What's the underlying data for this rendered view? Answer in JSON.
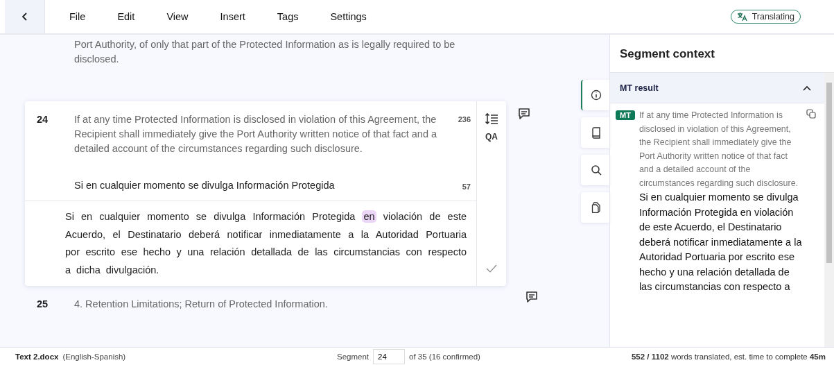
{
  "menu": [
    "File",
    "Edit",
    "View",
    "Insert",
    "Tags",
    "Settings"
  ],
  "status_badge": "Translating",
  "previous_segment": {
    "text": "Port Authority, of only that part of the Protected Information as is legally required to be disclosed."
  },
  "active_segment": {
    "number": "24",
    "source": "If at any time Protected Information is disclosed in violation of this Agreement, the Recipient shall immediately give the Port Authority written notice of that fact and a detailed account of the circumstances regarding such disclosure.",
    "source_count": "236",
    "suggestion": "Si en cualquier momento se divulga Información Protegida",
    "suggestion_count": "57",
    "qa": "QA",
    "target": {
      "before": "Si en cualquier momento se divulga Información Protegida",
      "highlight": "en",
      "after": "violación de este Acuerdo, el Destinatario deberá notificar inmediatamente a la Autoridad Portuaria por escrito ese hecho y una relación detallada de las circumstancias con respecto a dicha divulgación."
    },
    "confirmed": false
  },
  "next_segment": {
    "number": "25",
    "source": "4. Retention Limitations; Return of Protected Information."
  },
  "side_tabs": [
    {
      "kind": "info",
      "selected": true
    },
    {
      "kind": "book",
      "selected": false
    },
    {
      "kind": "search",
      "selected": false
    },
    {
      "kind": "copy",
      "selected": false
    }
  ],
  "context_panel": {
    "title": "Segment context",
    "section": "MT result",
    "expanded": true,
    "badge": "MT",
    "source": "If at any time Protected Information is disclosed in violation of this Agreement, the Recipient shall immediately give the Port Authority written notice of that fact and a detailed account of the circumstances regarding such disclosure.",
    "translation": "Si en cualquier momento se divulga Información Protegida en violación de este Acuerdo, el Destinatario deberá notificar inmediatamente a la Autoridad Portuaria por escrito ese hecho y una relación detallada de las circumstancias con respecto a"
  },
  "status_bar": {
    "file": "Text 2.docx",
    "languages": "(English-Spanish)",
    "segment_label": "Segment",
    "segment_value": "24",
    "segment_of": "of 35 (16 confirmed)",
    "progress": "**552 / 1102** words translated, est. time to complete **45m**"
  }
}
